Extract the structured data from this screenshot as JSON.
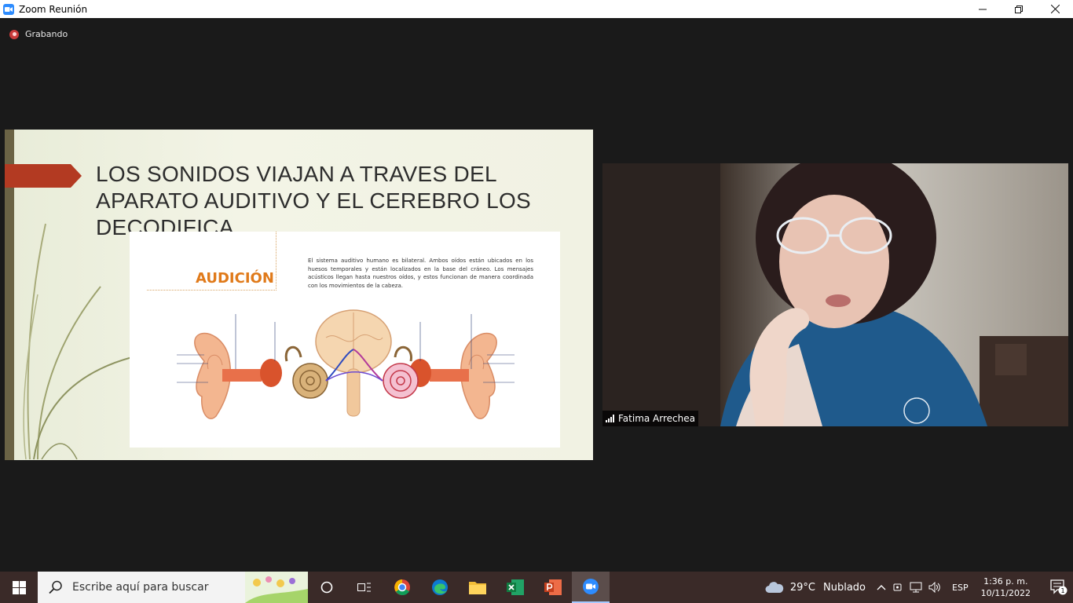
{
  "window": {
    "title": "Zoom Reunión",
    "minimize": "—",
    "restore": "❐",
    "close": "✕"
  },
  "recording": {
    "label": "Grabando"
  },
  "slide": {
    "title": "LOS SONIDOS VIAJAN A TRAVES DEL APARATO AUDITIVO Y EL CEREBRO LOS DECODIFICA.",
    "figure": {
      "heading": "AUDICIÓN",
      "description": "El sistema auditivo humano es bilateral. Ambos oídos están ubicados en los huesos temporales y están localizados en la base del cráneo. Los mensajes acústicos llegan hasta nuestros oídos, y estos funcionan de manera coordinada con los movimientos de la cabeza."
    }
  },
  "participant": {
    "name": "Fatima Arrechea"
  },
  "taskbar": {
    "search_placeholder": "Escribe aquí para buscar",
    "weather_temp": "29°C",
    "weather_condition": "Nublado",
    "language": "ESP",
    "time": "1:36 p. m.",
    "date": "10/11/2022",
    "notification_count": "1"
  },
  "colors": {
    "zoom_blue": "#2d8cff",
    "recording_red": "#c93b3b",
    "slide_arrow": "#b33a22",
    "figure_heading": "#e07a1a"
  }
}
